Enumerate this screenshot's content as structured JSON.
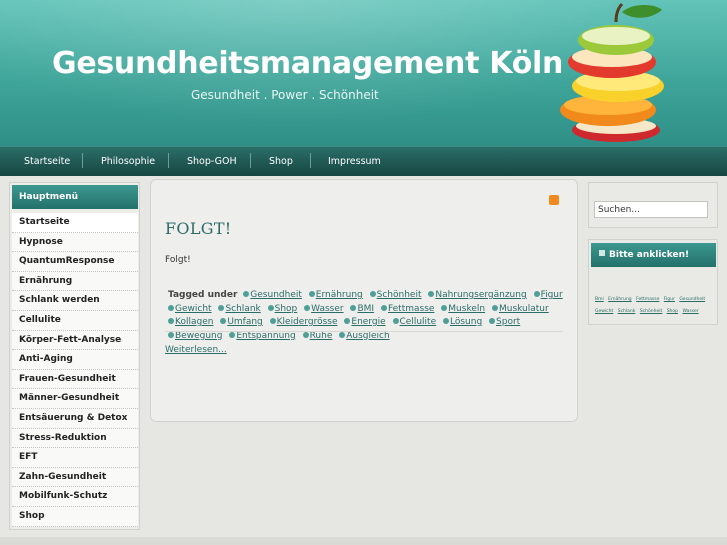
{
  "header": {
    "title": "Gesundheitsmanagement Köln",
    "slogan": "Gesundheit . Power . Schönheit"
  },
  "nav": [
    "Startseite",
    "Philosophie",
    "Shop-GOH",
    "Shop",
    "Impressum"
  ],
  "left_menu": {
    "title": "Hauptmenü",
    "items": [
      "Startseite",
      "Hypnose",
      "QuantumResponse",
      "Ernährung",
      "Schlank werden",
      "Cellulite",
      "Körper-Fett-Analyse",
      "Anti-Aging",
      "Frauen-Gesundheit",
      "Männer-Gesundheit",
      "Entsäuerung & Detox",
      "Stress-Reduktion",
      "EFT",
      "Zahn-Gesundheit",
      "Mobilfunk-Schutz",
      "Shop"
    ]
  },
  "article": {
    "title": "FOLGT!",
    "body": "Folgt!",
    "tags_label": "Tagged under",
    "tags": [
      "Gesundheit",
      "Ernährung",
      "Schönheit",
      "Nahrungsergänzung",
      "Figur",
      "Gewicht",
      "Schlank",
      "Shop",
      "Wasser",
      "BMI",
      "Fettmasse",
      "Muskeln",
      "Muskulatur",
      "Kollagen",
      "Umfang",
      "Kleidergrösse",
      "Energie",
      "Cellulite",
      "Lösung",
      "Sport",
      "Bewegung",
      "Entspannung",
      "Ruhe",
      "Ausgleich"
    ],
    "read_more": "Weiterlesen..."
  },
  "search": {
    "value": "Suchen..."
  },
  "right_panel": {
    "title": "Bitte anklicken!",
    "cloud": [
      "Bmi",
      "Ernährung",
      "Fettmasse",
      "Figur",
      "Gesundheit",
      "Gewicht",
      "Schlank",
      "Schönheit",
      "Shop",
      "Wasser"
    ]
  },
  "colors": {
    "teal_dark": "#23716b",
    "teal_light": "#63c4b9",
    "link": "#2a6d67"
  }
}
